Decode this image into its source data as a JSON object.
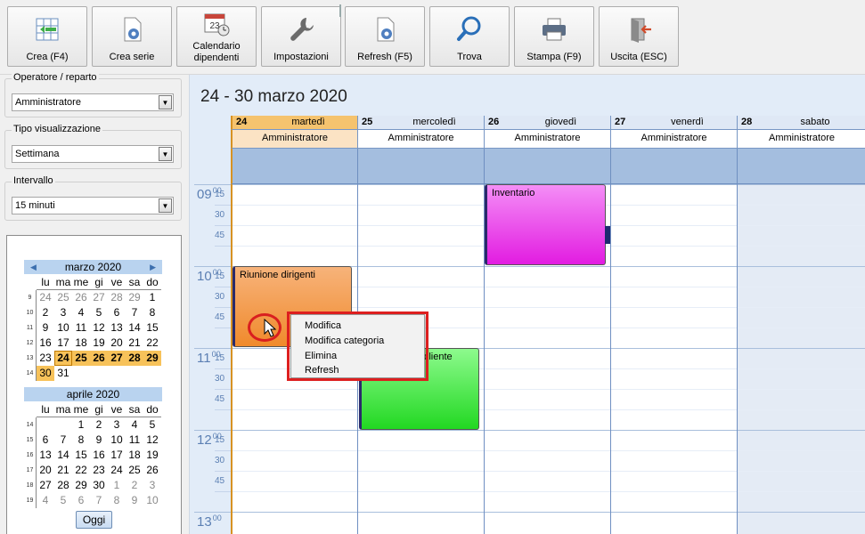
{
  "toolbar": {
    "buttons": [
      {
        "label": "Crea (F4)",
        "icon": "create-icon"
      },
      {
        "label": "Crea serie",
        "icon": "create-series-icon"
      },
      {
        "label": "Calendario\ndipendenti",
        "icon": "employee-calendar-icon"
      },
      {
        "label": "Impostazioni",
        "icon": "wrench-icon"
      },
      {
        "label": "Refresh (F5)",
        "icon": "refresh-icon"
      },
      {
        "label": "Trova",
        "icon": "magnifier-icon"
      },
      {
        "label": "Stampa (F9)",
        "icon": "printer-icon"
      },
      {
        "label": "Uscita (ESC)",
        "icon": "exit-door-icon"
      }
    ],
    "calendar_icon_day": "23"
  },
  "filters": {
    "operator": {
      "label": "Operatore / reparto",
      "value": "Amministratore"
    },
    "view_type": {
      "label": "Tipo visualizzazione",
      "value": "Settimana"
    },
    "interval": {
      "label": "Intervallo",
      "value": "15 minuti"
    }
  },
  "mini_calendar": {
    "dow": [
      "lu",
      "ma",
      "me",
      "gi",
      "ve",
      "sa",
      "do"
    ],
    "months": [
      {
        "title": "marzo 2020",
        "weeks": [
          "9",
          "10",
          "11",
          "12",
          "13",
          "14"
        ],
        "days": [
          "24",
          "25",
          "26",
          "27",
          "28",
          "29",
          "1",
          "2",
          "3",
          "4",
          "5",
          "6",
          "7",
          "8",
          "9",
          "10",
          "11",
          "12",
          "13",
          "14",
          "15",
          "16",
          "17",
          "18",
          "19",
          "20",
          "21",
          "22",
          "23",
          "24",
          "25",
          "26",
          "27",
          "28",
          "29",
          "30",
          "31"
        ]
      },
      {
        "title": "aprile 2020",
        "weeks": [
          "14",
          "15",
          "16",
          "17",
          "18",
          "19"
        ],
        "days": [
          "1",
          "2",
          "3",
          "4",
          "5",
          "6",
          "7",
          "8",
          "9",
          "10",
          "11",
          "12",
          "13",
          "14",
          "15",
          "16",
          "17",
          "18",
          "19",
          "20",
          "21",
          "22",
          "23",
          "24",
          "25",
          "26",
          "27",
          "28",
          "29",
          "30",
          "1",
          "2",
          "3",
          "4",
          "5",
          "6",
          "7",
          "8",
          "9",
          "10"
        ]
      }
    ],
    "today_button": "Oggi"
  },
  "calendar": {
    "range_title": "24 - 30 marzo 2020",
    "days": [
      {
        "num": "24",
        "name": "martedì",
        "resource": "Amministratore"
      },
      {
        "num": "25",
        "name": "mercoledì",
        "resource": "Amministratore"
      },
      {
        "num": "26",
        "name": "giovedì",
        "resource": "Amministratore"
      },
      {
        "num": "27",
        "name": "venerdì",
        "resource": "Amministratore"
      },
      {
        "num": "28",
        "name": "sabato",
        "resource": "Amministratore"
      }
    ],
    "hours": [
      {
        "hour": "09",
        "sup": "00",
        "quarters": [
          "15",
          "30",
          "45"
        ]
      },
      {
        "hour": "10",
        "sup": "00",
        "quarters": [
          "15",
          "30",
          "45"
        ]
      },
      {
        "hour": "11",
        "sup": "00",
        "quarters": [
          "15",
          "30",
          "45"
        ]
      },
      {
        "hour": "12",
        "sup": "00",
        "quarters": [
          "15",
          "30",
          "45"
        ]
      },
      {
        "hour": "13",
        "sup": "00",
        "quarters": []
      }
    ],
    "appointments": [
      {
        "title": "Inventario",
        "color": "#e21ce1"
      },
      {
        "title": "Riunione dirigenti",
        "color": "#f08a2c"
      },
      {
        "title": "ro cliente",
        "color": "#22d822"
      }
    ]
  },
  "context_menu": {
    "items": [
      "Modifica",
      "Modifica categoria",
      "Elimina",
      "Refresh"
    ]
  }
}
